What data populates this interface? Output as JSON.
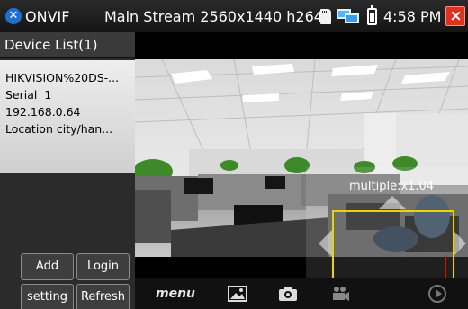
{
  "status_bar": {
    "app_name": "ONVIF",
    "stream_info": "Main Stream 2560x1440 h264",
    "time": "4:58 PM",
    "close_label": "×"
  },
  "device_panel": {
    "header": "Device List(1)",
    "device": {
      "name": "HIKVISION%20DS-...",
      "serial": "Serial  1",
      "ip": "192.168.0.64",
      "location": "Location city/han..."
    },
    "buttons": {
      "add": "Add",
      "login": "Login",
      "setting": "setting",
      "refresh": "Refresh"
    }
  },
  "video": {
    "zoom_label": "multiple:x1.04"
  },
  "toolbar": {
    "menu": "menu"
  },
  "colors": {
    "zoom_box": "#e8d500",
    "close_button": "#e0301e",
    "app_logo": "#1f6fd0"
  }
}
